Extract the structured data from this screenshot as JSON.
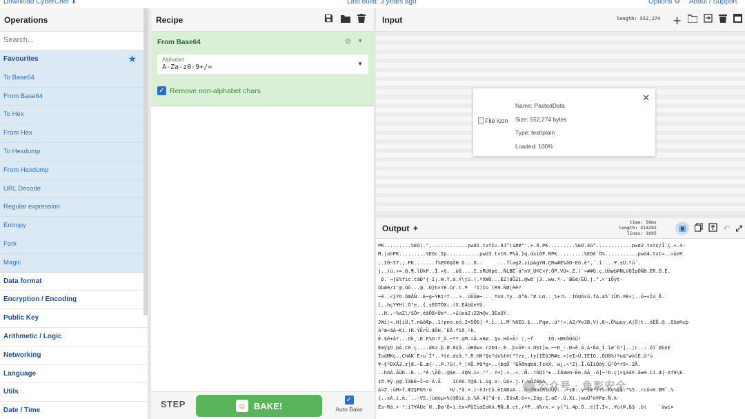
{
  "topbar": {
    "download": "Download CyberChef",
    "last_build": "Last build: 3 years ago",
    "options": "Options",
    "about": "About / Support"
  },
  "operations": {
    "title": "Operations",
    "search_placeholder": "Search...",
    "favourites": "Favourites",
    "favourite_items": [
      "To Base64",
      "From Base64",
      "To Hex",
      "From Hex",
      "To Hexdump",
      "From Hexdump",
      "URL Decode",
      "Regular expression",
      "Entropy",
      "Fork",
      "Magic"
    ],
    "categories": [
      "Data format",
      "Encryption / Encoding",
      "Public Key",
      "Arithmetic / Logic",
      "Networking",
      "Language",
      "Utils",
      "Date / Time"
    ]
  },
  "recipe": {
    "title": "Recipe",
    "operation": {
      "name": "From Base64",
      "alphabet_label": "Alphabet",
      "alphabet_value": "A-Za-z0-9+/=",
      "remove_nonalpha_label": "Remove non-alphabet chars"
    },
    "step_label": "STEP",
    "bake_label": "BAKE!",
    "autobake_label": "Auto Bake"
  },
  "input": {
    "title": "Input",
    "length": "length: 552,274",
    "file": {
      "icon_alt": "File icon",
      "name": "Name: PastedData",
      "size": "Size: 552,274 bytes",
      "type": "Type: text/plain",
      "loaded": "Loaded: 100%"
    }
  },
  "output": {
    "title": "Output",
    "time": "time:  50ms",
    "length": "length: 414202",
    "lines": "lines:   1685",
    "text": "PK.........%EO|.\",............pwd1.txtIu.3J^)1##\"'.+.ð.PK.........%EO.4G°............pwd2.txt¢/Î`Ç.+.4-\nM.|o©PK.........%EOc.Ip...........pwd3.txtN.P%ä.}q.dxiÖF.NPK.........%EOè´Ö%...........pwd4.txt=..>ùm¥.\n,.ÍÓ~Í7.;.PK.......f%EOO§ÖH O...O..     ...flag2.zip&gYN.ÇRw#É%ãD-Éõ.è³,´.î....¥.±Ü.ºü´.\nj..)ü.÷=.@.¶.lÜkP..Î.×§. .öß....I.sRUHpè..ÑLBÉ¯ä\"nV_Ù®C<Y.ÖP.VÙ×.Z.)`»##G.ç.UãwbÞNLVQÎpÖÑ8.ÈR.Ò.È.\n Ð.`¬[E%fic.tãÐ\"{-I¡.W.Y.à.Ý\\jS.(.ªXWÜ...ßZ)äÕ2î.@wõ¨|3..ww.ª-.´BÈé/ÈÜ.j.°.×'íÕÿt-\nöbÆé/I'@.Öö...@..Ú}h×ÝE.ür.t.¥  ³I)Ìo´(R9.ÑØ(èë?\n~é..<}ÝO.õÆÅÑ..È~g~ÝRI³T...>..ÚÛÜæ~..._TnU.Ty..D°6.^#.Lm..¸%+?L .ÌÖQÄsü.fA.á5¨íÜh.®È×¦..Ü¬«Ïú_Å..\n[..hçÝ¥H(.Ò°e..{.sÉÖTÕX¡.(X.EÂbÜeYÜ.\n..H..~%aZl/$Ör.éãÖß>Üe*..»£úxàZ¡2Zm@v.3ÈuÚÝ.\nJWí¦<.H[ìÜ.7.n&õÆp..1!pnò.eó.2=5Ö6]·ª.î..L.M´%6EG.$...Pqø..ú\"!«.À2/¥v3B.V}.8¬.Ö%µúy.A|Ö¦t..óÉÖ.@..Q$ø®±þ\nä³æ«ãÁ~Ki.)R.ÝÊrÜ.ÆÖH.¯ÈÅ.fïð.!k.\nÊ.$é+ä?...Ök¸.D.F%O.Ý_ö.~ªY.qM.=Â.±6ø..§v.Hö>Ã! ¦,~f     ÏÖ.»ÐEãÖöü!\nÉmÿ§Ö.þÃ.C0.ç....dKz.þ.Ø.8¢ä..ÜHÓw».rZÞ4·.È..þ×Ä¥:¤.OSt]w.~~D_-.Ð»è.Ã.Ä·ßÀ_Î.ìæ¨ö³]..¦c..:.öï¨Øü££\nÏoãMKç..ChÀK´Èru`Î³..ªté.d¢ã.\".R.HH³§o³dx%t®(³?zz_.ty{IÊõJR#±.×¦eÌ»Ü.IEÍG..OÚß%)ªo&\"wàlÉ.Ù³ü\n¥~§ºÐXÅ3.z]Æ.~È.æ{·..Þ.?G(.ª_¦XÖ.¥0ªg»..{bqÖ¯³ßÃðnqbã.TckX. w¿.»\"Z{.Î.GÏïÖóÿ.Û³Ö*r5>.2Å.\n..hòÁ.ÃÜD..E...³ê.\\ÃÖ..@$e..3QN.1«.³³..Ý+].×..<..Ñ..ºÙQï³±..Ïã3øn-Ëe.ãÃ_.ó]~³b.ç¦¤§3£F.ä±H.Cí.Æ|-Af9\\E.\n¢ð.¥ÿ.p@.ÏàÈÉ~Î~o·À.Ä    1CëÀ.T@ã.L.ig.V-.Ùó«.j.r.wÕZ66A\nA¤Z.:üM>f.ÆZ§PGS·ú      H/.³ã.+.)-èJrCö.èIAÐxA...ñ~éWaiR1üÜÿ...~¢Æ:.y~Ìæ³)?s.Kç%§§.³%5..rcö¤K.ÐM¨.%\n{..xA.í.ë.¯..~VS.|ùdùµ»%(@Öìù.þ.%Ä.4]^d·é..ÊõsÆ.õ×»,2ög.Ç.aÈ·.Ù.Xí.|wuÜ³ö®Pæ.Ñ.k-\nËs~Rã.+ ³:i7¥ÃÜe¨H..Dø'Ö«ì.ëx»PÜÌìæIoKó.¶Ñ.8.ct./ªP..ä%rx.» y{³ì.4p.Ö..ë]Ï.Ì<..¥ú{Þ.ß$ .ö(    `àwi¤"
  }
}
